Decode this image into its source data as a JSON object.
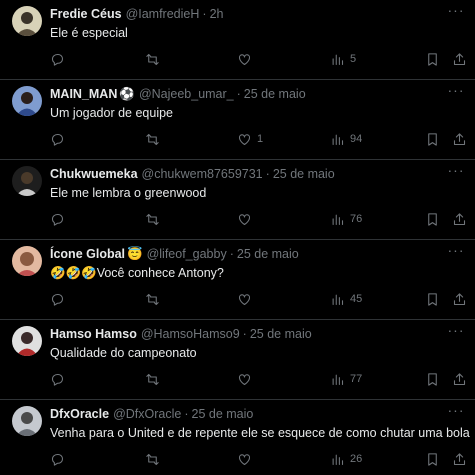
{
  "tweets": [
    {
      "name": "Fredie Céus",
      "badge": "",
      "handle": "@IamfredieH",
      "time": "2h",
      "text": "Ele é especial",
      "replies": "",
      "retweets": "",
      "likes": "",
      "views": "5",
      "avatar_color": "#c9c2a8",
      "avatar_icon": "avatar-photo"
    },
    {
      "name": "MAIN_MAN",
      "badge": "⚽",
      "handle": "@Najeeb_umar_",
      "time": "25 de maio",
      "text": "Um jogador de equipe",
      "replies": "",
      "retweets": "",
      "likes": "1",
      "views": "94",
      "avatar_color": "#3b4e8c",
      "avatar_icon": "avatar-photo"
    },
    {
      "name": "Chukwuemeka",
      "badge": "",
      "handle": "@chukwem87659731",
      "time": "25 de maio",
      "text": "Ele me lembra o greenwood",
      "replies": "",
      "retweets": "",
      "likes": "",
      "views": "76",
      "avatar_color": "#2b2b2b",
      "avatar_icon": "avatar-photo"
    },
    {
      "name": "Ícone Global",
      "badge": "😇",
      "handle": "@lifeof_gabby",
      "time": "25 de maio",
      "text": "🤣🤣🤣Você conhece Antony?",
      "replies": "",
      "retweets": "",
      "likes": "",
      "views": "45",
      "avatar_color": "#c98a6b",
      "avatar_icon": "avatar-photo"
    },
    {
      "name": "Hamso Hamso",
      "badge": "",
      "handle": "@HamsoHamso9",
      "time": "25 de maio",
      "text": "Qualidade do campeonato",
      "replies": "",
      "retweets": "",
      "likes": "",
      "views": "77",
      "avatar_color": "#a83232",
      "avatar_icon": "avatar-photo"
    },
    {
      "name": "DfxOracle",
      "badge": "",
      "handle": "@DfxOracle",
      "time": "25 de maio",
      "text": "Venha para o United e de repente ele se esquece de como chutar uma bola",
      "replies": "",
      "retweets": "",
      "likes": "",
      "views": "26",
      "avatar_color": "#8a8f96",
      "avatar_icon": "avatar-photo"
    }
  ],
  "colors": {
    "background": "#000000",
    "text": "#e7e9ea",
    "muted": "#71767b",
    "divider": "#2f3336"
  },
  "icons": [
    "reply-icon",
    "retweet-icon",
    "like-icon",
    "views-icon",
    "bookmark-icon",
    "share-icon",
    "more-icon"
  ]
}
